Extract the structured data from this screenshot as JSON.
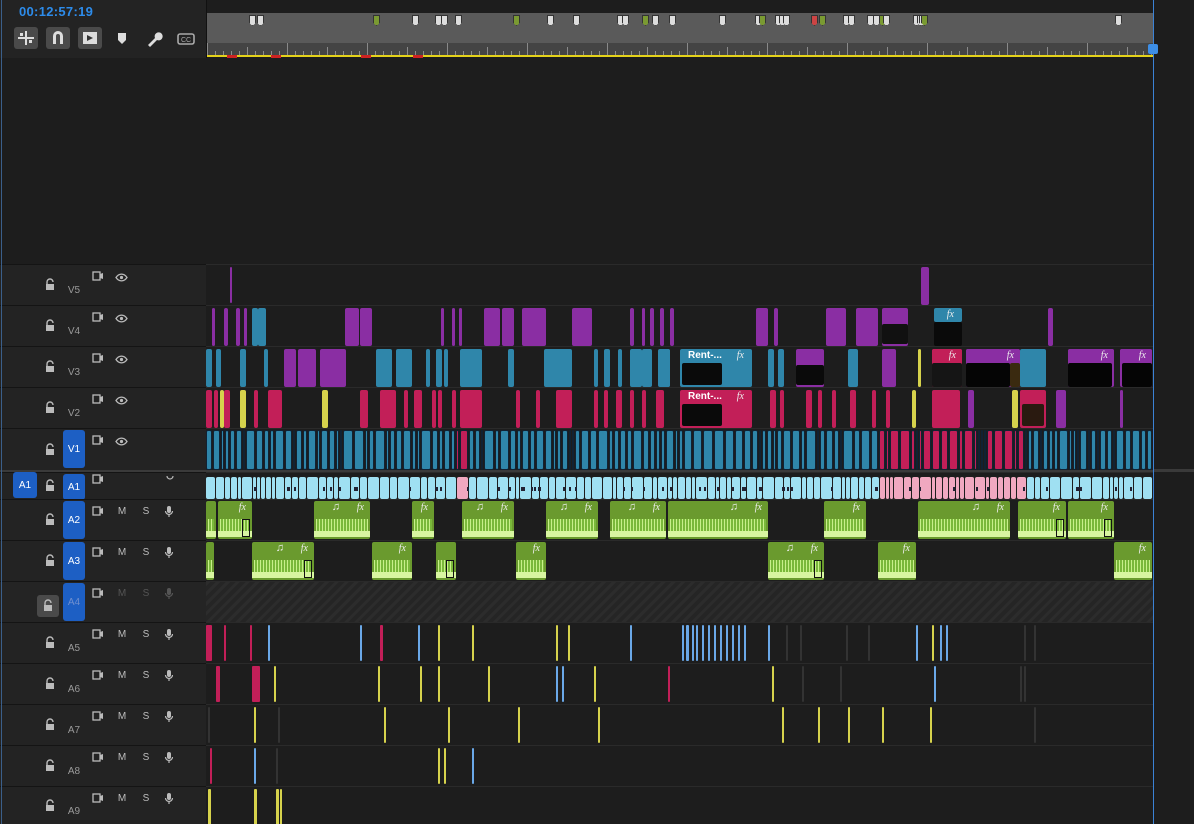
{
  "timecode": "00:12:57:19",
  "toolbar": [
    {
      "name": "insert-overwrite-icon",
      "active": true
    },
    {
      "name": "snap-icon",
      "active": true
    },
    {
      "name": "linked-selection-icon",
      "active": true
    },
    {
      "name": "add-marker-icon",
      "active": false
    },
    {
      "name": "timeline-settings-icon",
      "active": false
    },
    {
      "name": "captions-icon",
      "active": false
    }
  ],
  "source_patch": "A1",
  "tracks": [
    {
      "id": "V5",
      "kind": "video"
    },
    {
      "id": "V4",
      "kind": "video"
    },
    {
      "id": "V3",
      "kind": "video"
    },
    {
      "id": "V2",
      "kind": "video"
    },
    {
      "id": "V1",
      "kind": "video",
      "targeted": true
    },
    {
      "id": "A1",
      "kind": "audio",
      "targeted": true
    },
    {
      "id": "A2",
      "kind": "audio",
      "targeted": true,
      "m": "M",
      "s": "S"
    },
    {
      "id": "A3",
      "kind": "audio",
      "targeted": true,
      "m": "M",
      "s": "S"
    },
    {
      "id": "A4",
      "kind": "audio",
      "targeted": true,
      "locked": true,
      "m": "M",
      "s": "S"
    },
    {
      "id": "A5",
      "kind": "audio",
      "m": "M",
      "s": "S"
    },
    {
      "id": "A6",
      "kind": "audio",
      "m": "M",
      "s": "S"
    },
    {
      "id": "A7",
      "kind": "audio",
      "m": "M",
      "s": "S"
    },
    {
      "id": "A8",
      "kind": "audio",
      "m": "M",
      "s": "S"
    },
    {
      "id": "A9",
      "kind": "audio",
      "m": "M",
      "s": "S"
    }
  ],
  "clip_labels": {
    "rent": "Rent-...",
    "fx": "fx",
    "music": "♫"
  },
  "colors": {
    "purple": "#8a2ea3",
    "blue": "#2f86aa",
    "red": "#c21f58",
    "green": "#6a9a2e",
    "lightblue": "#9fe0f2",
    "yellow": "#d6d24c",
    "playhead": "#3b82d6"
  }
}
